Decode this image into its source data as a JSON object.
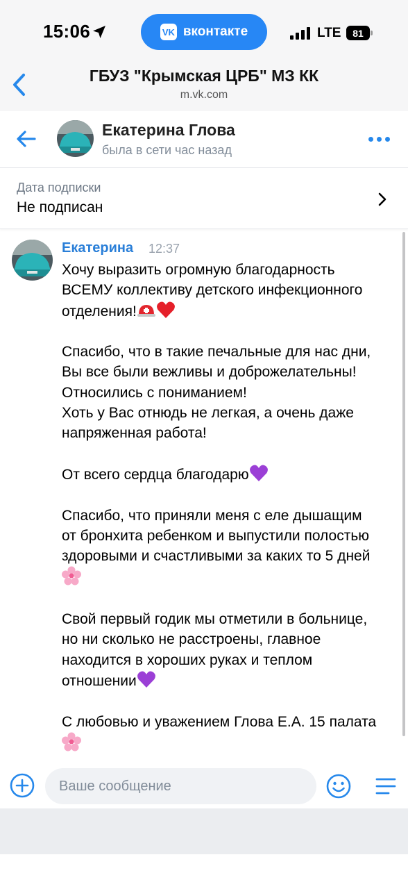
{
  "status_bar": {
    "time": "15:06",
    "vk_pill_label": "вконтакте",
    "network": "LTE",
    "battery": "81"
  },
  "browser": {
    "title": "ГБУЗ \"Крымская ЦРБ\" МЗ КК",
    "url": "m.vk.com"
  },
  "chat_header": {
    "name": "Екатерина Глова",
    "status": "была в сети час назад"
  },
  "subscription": {
    "label": "Дата подписки",
    "value": "Не подписан"
  },
  "message": {
    "author": "Екатерина",
    "time": "12:37",
    "paragraphs": [
      "Хочу выразить огромную благодарность\nВСЕМУ коллективу детского инфекционного\nотделения!",
      "Спасибо, что в такие печальные для нас дни,\nВы все были вежливы и доброжелательны!\nОтносились с пониманием!\nХоть у Вас отнюдь не легкая, а очень даже\nнапряженная работа!",
      "От всего сердца благодарю",
      "Спасибо, что приняли меня с еле дышащим\nот бронхита ребенком и выпустили полостью\nздоровыми и счастливыми за каких то 5 дней",
      "Свой первый годик мы отметили в больнице,\nно ни сколько не расстроены, главное\nнаходится в хороших руках и теплом\nотношении",
      "С любовью и уважением Глова Е.А. 15 палата"
    ]
  },
  "composer": {
    "placeholder": "Ваше сообщение"
  },
  "colors": {
    "accent": "#2688eb",
    "author": "#2a7fd8",
    "muted": "#818c99",
    "vk_blue": "#2787f5"
  },
  "icons": [
    "location-arrow-icon",
    "vk-logo-icon",
    "signal-icon",
    "battery-icon",
    "back-chevron-icon",
    "back-arrow-icon",
    "more-dots-icon",
    "chevron-right-icon",
    "add-circle-icon",
    "smile-icon",
    "menu-icon",
    "rescue-helmet-emoji",
    "red-heart-emoji",
    "purple-heart-emoji",
    "cherry-blossom-emoji"
  ]
}
